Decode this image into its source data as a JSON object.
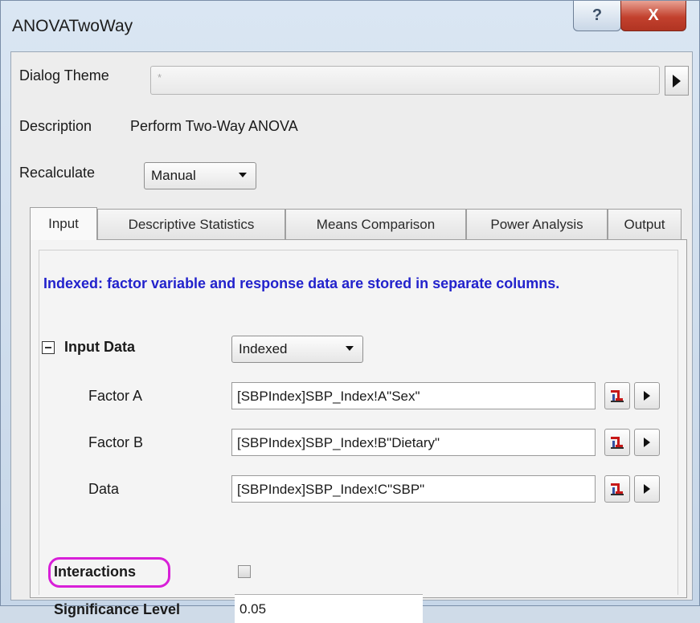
{
  "window": {
    "title": "ANOVATwoWay",
    "help_glyph": "?",
    "close_glyph": "X"
  },
  "dialog_theme": {
    "label": "Dialog Theme",
    "value": "*"
  },
  "description": {
    "label": "Description",
    "value": "Perform Two-Way ANOVA"
  },
  "recalculate": {
    "label": "Recalculate",
    "value": "Manual"
  },
  "tabs": [
    {
      "label": "Input",
      "active": true
    },
    {
      "label": "Descriptive Statistics",
      "active": false
    },
    {
      "label": "Means Comparison",
      "active": false
    },
    {
      "label": "Power Analysis",
      "active": false
    },
    {
      "label": "Output",
      "active": false
    }
  ],
  "input": {
    "info_text": "Indexed: factor variable and response data are stored in separate columns.",
    "input_data": {
      "label": "Input Data",
      "value": "Indexed"
    },
    "factor_a": {
      "label": "Factor A",
      "value": "[SBPIndex]SBP_Index!A\"Sex\""
    },
    "factor_b": {
      "label": "Factor B",
      "value": "[SBPIndex]SBP_Index!B\"Dietary\""
    },
    "data": {
      "label": "Data",
      "value": "[SBPIndex]SBP_Index!C\"SBP\""
    },
    "interactions": {
      "label": "Interactions",
      "checked": false
    },
    "significance": {
      "label": "Significance Level",
      "value": "0.05"
    }
  },
  "colors": {
    "info_text": "#2222cc",
    "highlight": "#d81fd8",
    "close_button": "#c2412e"
  }
}
